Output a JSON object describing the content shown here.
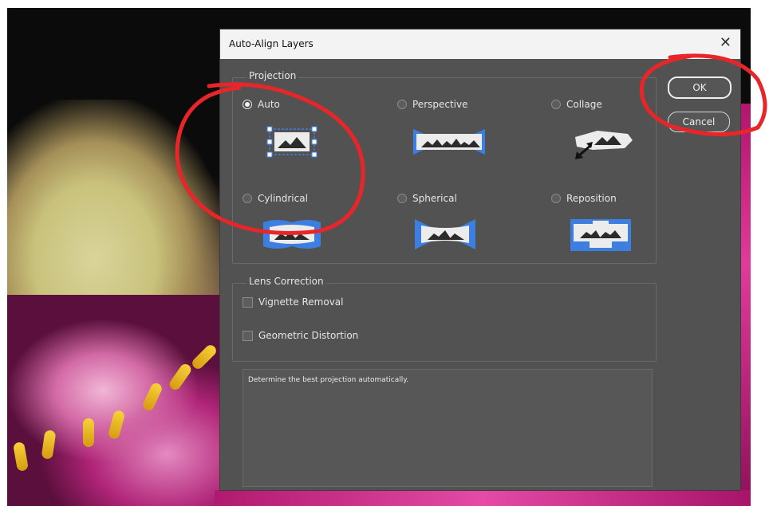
{
  "dialog": {
    "title": "Auto-Align Layers",
    "close_label": "✕"
  },
  "projection": {
    "legend": "Projection",
    "options": [
      {
        "label": "Auto",
        "selected": true,
        "icon": "auto-projection-icon"
      },
      {
        "label": "Perspective",
        "selected": false,
        "icon": "perspective-projection-icon"
      },
      {
        "label": "Collage",
        "selected": false,
        "icon": "collage-projection-icon"
      },
      {
        "label": "Cylindrical",
        "selected": false,
        "icon": "cylindrical-projection-icon"
      },
      {
        "label": "Spherical",
        "selected": false,
        "icon": "spherical-projection-icon"
      },
      {
        "label": "Reposition",
        "selected": false,
        "icon": "reposition-projection-icon"
      }
    ]
  },
  "lens_correction": {
    "legend": "Lens Correction",
    "vignette_label": "Vignette Removal",
    "vignette_checked": false,
    "distortion_label": "Geometric Distortion",
    "distortion_checked": false
  },
  "buttons": {
    "ok_label": "OK",
    "cancel_label": "Cancel"
  },
  "description": "Determine the best projection automatically.",
  "colors": {
    "dialog_bg": "#525252",
    "icon_blue": "#3d7fe0",
    "annotation_red": "#e8262a"
  }
}
